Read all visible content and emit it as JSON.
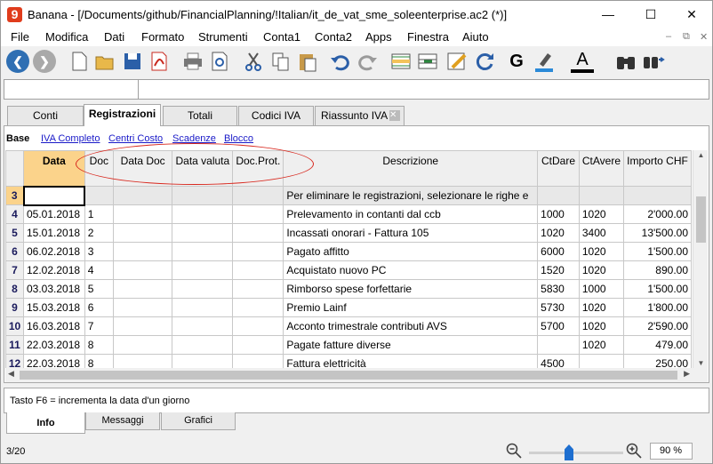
{
  "window": {
    "title": "Banana - [/Documents/github/FinancialPlanning/!Italian/it_de_vat_sme_soleenterprise.ac2 (*)]",
    "app_icon": "9",
    "minimize": "—",
    "maximize": "☐",
    "close": "✕"
  },
  "menu": [
    "File",
    "Modifica",
    "Dati",
    "Formato",
    "Strumenti",
    "Conta1",
    "Conta2",
    "Apps",
    "Finestra",
    "Aiuto"
  ],
  "mdi_controls": [
    "–",
    "⧉",
    "✕"
  ],
  "toolbar": {
    "icons": [
      "back-icon",
      "forward-icon",
      "new-file-icon",
      "open-folder-icon",
      "save-icon",
      "pdf-icon",
      "print-icon",
      "print-preview-icon",
      "cut-icon",
      "copy-icon",
      "paste-icon",
      "undo-icon",
      "redo-icon",
      "add-row-icon",
      "move-row-icon",
      "edit-icon",
      "refresh-icon",
      "bold-icon",
      "highlight-icon",
      "font-color-icon",
      "binoculars-icon",
      "find-next-icon"
    ],
    "bold_label": "G",
    "font_label": "A"
  },
  "tabs": [
    "Conti",
    "Registrazioni",
    "Totali",
    "Codici IVA",
    "Riassunto IVA"
  ],
  "tab_close": "✕",
  "views": {
    "base": "Base",
    "links": [
      "IVA Completo",
      "Centri Costo",
      "Scadenze",
      "Blocco"
    ]
  },
  "table": {
    "headers": [
      "",
      "Data",
      "Doc",
      "Data Doc",
      "Data valuta",
      "Doc.Prot.",
      "Descrizione",
      "CtDare",
      "CtAvere",
      "Importo CHF"
    ],
    "rows": [
      [
        "3",
        "",
        "",
        "",
        "",
        "",
        "Per eliminare le registrazioni, selezionare le righe e",
        "",
        "",
        ""
      ],
      [
        "4",
        "05.01.2018",
        "1",
        "",
        "",
        "",
        "Prelevamento in contanti dal ccb",
        "1000",
        "1020",
        "2'000.00"
      ],
      [
        "5",
        "15.01.2018",
        "2",
        "",
        "",
        "",
        "Incassati onorari - Fattura 105",
        "1020",
        "3400",
        "13'500.00"
      ],
      [
        "6",
        "06.02.2018",
        "3",
        "",
        "",
        "",
        "Pagato affitto",
        "6000",
        "1020",
        "1'500.00"
      ],
      [
        "7",
        "12.02.2018",
        "4",
        "",
        "",
        "",
        "Acquistato nuovo PC",
        "1520",
        "1020",
        "890.00"
      ],
      [
        "8",
        "03.03.2018",
        "5",
        "",
        "",
        "",
        "Rimborso spese forfettarie",
        "5830",
        "1000",
        "1'500.00"
      ],
      [
        "9",
        "15.03.2018",
        "6",
        "",
        "",
        "",
        "Premio Lainf",
        "5730",
        "1020",
        "1'800.00"
      ],
      [
        "10",
        "16.03.2018",
        "7",
        "",
        "",
        "",
        "Acconto trimestrale contributi AVS",
        "5700",
        "1020",
        "2'590.00"
      ],
      [
        "11",
        "22.03.2018",
        "8",
        "",
        "",
        "",
        "Pagate fatture diverse",
        "",
        "1020",
        "479.00"
      ],
      [
        "12",
        "22.03.2018",
        "8",
        "",
        "",
        "",
        "Fattura elettricità",
        "4500",
        "",
        "250.00"
      ]
    ]
  },
  "info": {
    "text": "Tasto F6 = incrementa la data d'un giorno"
  },
  "bottom_tabs": [
    "Info",
    "Messaggi",
    "Grafici"
  ],
  "status": {
    "page": "3/20",
    "zoom": "90 %",
    "zoom_out": "−",
    "zoom_in": "+"
  },
  "colors": {
    "accent": "#fbd38b",
    "annotation": "#d8281e",
    "link": "#1a1ac8"
  }
}
